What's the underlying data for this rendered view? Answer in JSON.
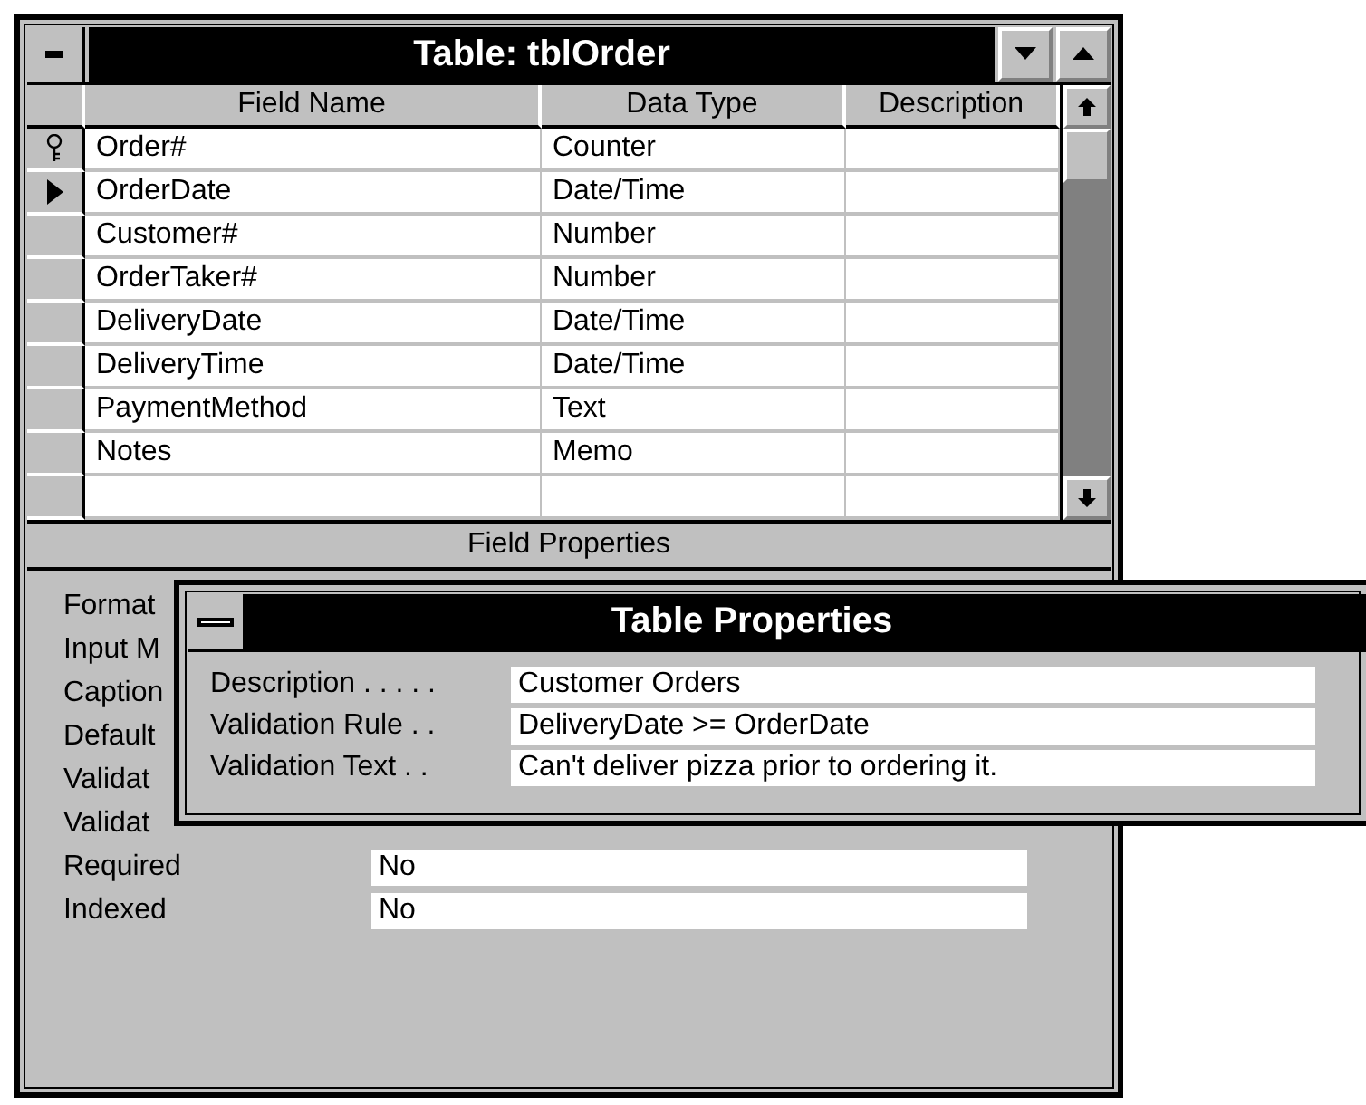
{
  "window": {
    "title": "Table: tblOrder"
  },
  "table": {
    "columns": [
      "Field Name",
      "Data Type",
      "Description"
    ],
    "rows": [
      {
        "field_name": "Order#",
        "data_type": "Counter",
        "primary_key": true,
        "current": false
      },
      {
        "field_name": "OrderDate",
        "data_type": "Date/Time",
        "primary_key": false,
        "current": true
      },
      {
        "field_name": "Customer#",
        "data_type": "Number",
        "primary_key": false,
        "current": false
      },
      {
        "field_name": "OrderTaker#",
        "data_type": "Number",
        "primary_key": false,
        "current": false
      },
      {
        "field_name": "DeliveryDate",
        "data_type": "Date/Time",
        "primary_key": false,
        "current": false
      },
      {
        "field_name": "DeliveryTime",
        "data_type": "Date/Time",
        "primary_key": false,
        "current": false
      },
      {
        "field_name": "PaymentMethod",
        "data_type": "Text",
        "primary_key": false,
        "current": false
      },
      {
        "field_name": "Notes",
        "data_type": "Memo",
        "primary_key": false,
        "current": false
      }
    ]
  },
  "field_properties": {
    "title": "Field Properties",
    "items": [
      {
        "label": "Format"
      },
      {
        "label": "Input M"
      },
      {
        "label": "Caption"
      },
      {
        "label": "Default"
      },
      {
        "label": "Validat"
      },
      {
        "label": "Validat"
      },
      {
        "label": "Required",
        "value": "No"
      },
      {
        "label": "Indexed",
        "value": "No"
      }
    ]
  },
  "table_properties": {
    "title": "Table Properties",
    "items": [
      {
        "label": "Description . . . . .",
        "value": "Customer Orders"
      },
      {
        "label": "Validation Rule . .",
        "value": "DeliveryDate >= OrderDate"
      },
      {
        "label": "Validation Text . .",
        "value": "Can't deliver pizza prior to ordering it."
      }
    ]
  }
}
